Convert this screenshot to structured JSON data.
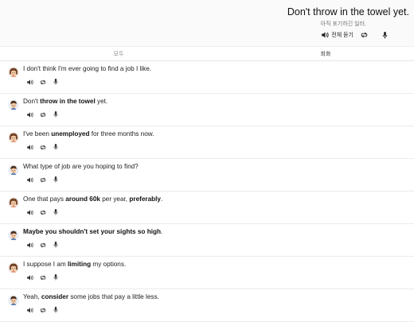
{
  "header": {
    "title": "Don't throw in the towel yet.",
    "subtitle": "아직 포기하긴 일러.",
    "listen_all_label": "전체 듣기"
  },
  "tabs": [
    {
      "label": "모두",
      "selected": false
    },
    {
      "label": "회화",
      "selected": true
    }
  ],
  "dialogue": [
    {
      "speaker": "female",
      "parts": [
        {
          "text": "I don't think I'm ever going to find a job I like.",
          "bold": false
        }
      ]
    },
    {
      "speaker": "male",
      "parts": [
        {
          "text": "Don't ",
          "bold": false
        },
        {
          "text": "throw in the towel",
          "bold": true
        },
        {
          "text": " yet.",
          "bold": false
        }
      ]
    },
    {
      "speaker": "female",
      "parts": [
        {
          "text": "I've been ",
          "bold": false
        },
        {
          "text": "unemployed",
          "bold": true
        },
        {
          "text": " for three months now.",
          "bold": false
        }
      ]
    },
    {
      "speaker": "male",
      "parts": [
        {
          "text": "What type of job are you hoping to find?",
          "bold": false
        }
      ]
    },
    {
      "speaker": "female",
      "parts": [
        {
          "text": "One that pays ",
          "bold": false
        },
        {
          "text": "around 60k",
          "bold": true
        },
        {
          "text": " per year, ",
          "bold": false
        },
        {
          "text": "preferably",
          "bold": true
        },
        {
          "text": ".",
          "bold": false
        }
      ]
    },
    {
      "speaker": "male",
      "parts": [
        {
          "text": "Maybe you shouldn't set your sights so high",
          "bold": true
        },
        {
          "text": ".",
          "bold": false
        }
      ]
    },
    {
      "speaker": "female",
      "parts": [
        {
          "text": "I suppose I am ",
          "bold": false
        },
        {
          "text": "limiting",
          "bold": true
        },
        {
          "text": " my options.",
          "bold": false
        }
      ]
    },
    {
      "speaker": "male",
      "parts": [
        {
          "text": "Yeah, ",
          "bold": false
        },
        {
          "text": "consider",
          "bold": true
        },
        {
          "text": " some jobs that pay a little less.",
          "bold": false
        }
      ]
    }
  ],
  "icons": {
    "play": "speaker-icon",
    "repeat": "repeat-icon",
    "record": "microphone-icon",
    "female_avatar": "female-avatar-icon",
    "male_avatar": "male-avatar-icon"
  },
  "colors": {
    "header_bg": "#fafafa",
    "tab_selected_underline": "#555555",
    "divider": "#ececec",
    "female_hair": "#6b3d22",
    "male_hair": "#4a2f1e",
    "skin": "#f3c9a4"
  }
}
